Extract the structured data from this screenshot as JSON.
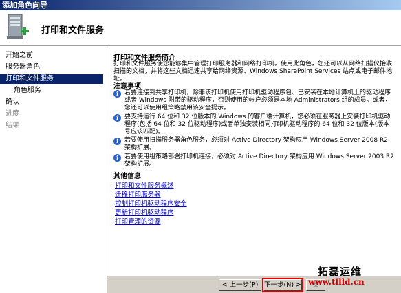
{
  "window": {
    "title": "添加角色向导"
  },
  "header": {
    "title": "打印和文件服务",
    "icon": "server-add-icon"
  },
  "sidebar": {
    "items": [
      {
        "label": "开始之前",
        "state": "normal"
      },
      {
        "label": "服务器角色",
        "state": "normal"
      },
      {
        "label": "打印和文件服务",
        "state": "selected"
      },
      {
        "label": "角色服务",
        "state": "normal"
      },
      {
        "label": "确认",
        "state": "normal"
      },
      {
        "label": "进度",
        "state": "disabled"
      },
      {
        "label": "结果",
        "state": "disabled"
      }
    ]
  },
  "main": {
    "intro_title": "打印和文件服务简介",
    "intro_text": "打印和文件服务使您能够集中管理打印服务器和网络打印机。使用此角色，您还可以从网络扫描仪接收扫描的文档，并将这些文档迅速共享给网络资源、Windows SharePoint Services 站点或电子邮件地址。",
    "notes_title": "注意事项",
    "notes": [
      "若要连接到共享打印机，除非该打印机使用打印机驱动程序包、已安装在本地计算机上的驱动程序或者 Windows 附带的驱动程序，否则使用的帐户必须是本地 Administrators 组的成员。或者，您还可以使用组策略禁用该安全提示。",
      "要支持运行 64 位和 32 位版本的 Windows 的客户端计算机，您必须在服务器上安装打印机驱动程序(包括 64 位和 32 位驱动程序)或者单独安装相同打印机驱动程序的 64 位和 32 位版本(版本号应该匹配)。",
      "若要使用扫描服务器角色服务，必须对 Active Directory 架构应用 Windows Server 2008 R2 架构扩展。",
      "若要使用组策略部署打印机连接，必须对 Active Directory 架构应用 Windows Server 2003 R2 架构扩展。"
    ],
    "more_title": "其他信息",
    "links": [
      "打印和文件服务概述",
      "迁移打印服务器",
      "控制打印机驱动程序安全",
      "更新打印机驱动程序",
      "打印管理的资源"
    ]
  },
  "buttons": {
    "prev": "< 上一步(P)",
    "next": "下一步(N) >",
    "install": "安"
  },
  "watermark": {
    "text": "拓磊运维",
    "url": "www.tllld.cn"
  }
}
